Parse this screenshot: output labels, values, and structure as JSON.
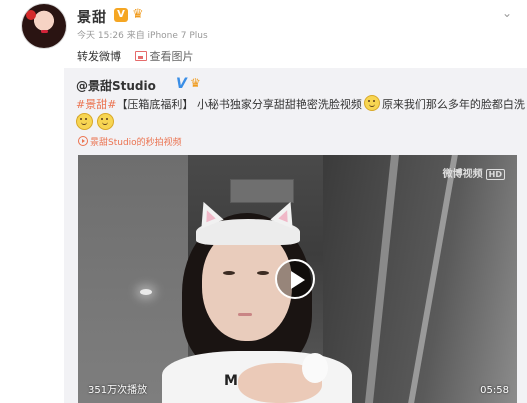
{
  "post": {
    "author": "景甜",
    "time": "今天 15:26",
    "source": "来自 iPhone 7 Plus",
    "repost_label": "转发微博",
    "view_pic_label": "查看图片"
  },
  "repost": {
    "original_author": "@景甜Studio",
    "topic_tag": "#景甜#",
    "bracket_tag": "【压箱底福利】",
    "text_part1": "小秘书独家分享甜甜艳密洗脸视频",
    "text_part2": "原来我们那么多年的脸都白洗了",
    "video_link_label": "景甜Studio的秒拍视频"
  },
  "video": {
    "watermark": "微博视频",
    "hd_label": "HD",
    "shirt_text": "M",
    "play_count": "351万次播放",
    "duration": "05:58"
  },
  "colors": {
    "link_orange": "#eb7350",
    "verified_blue": "#3a8ee6",
    "card_bg": "#f2f2f5"
  }
}
